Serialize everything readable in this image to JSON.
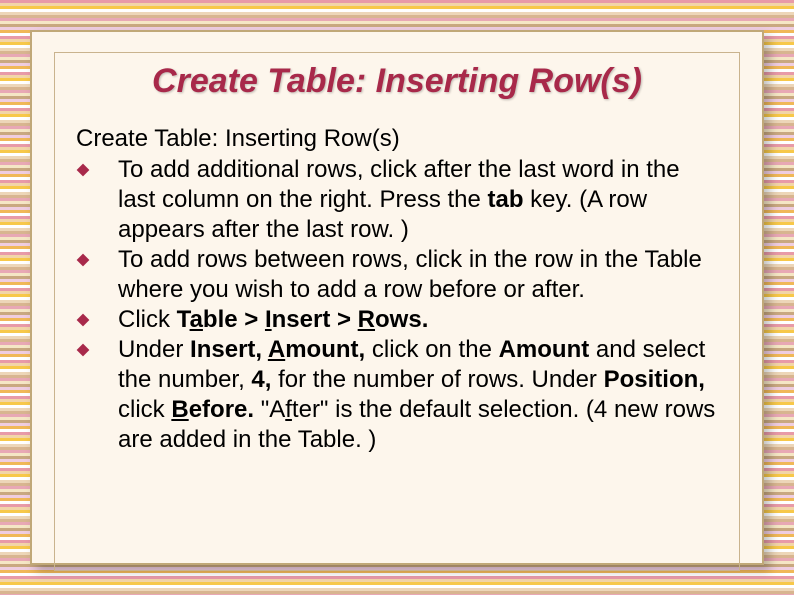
{
  "title": "Create Table: Inserting Row(s)",
  "subtitle": "Create Table: Inserting Row(s)",
  "icon_fill": "#a8294a",
  "bullets": [
    {
      "segments": [
        {
          "t": "To add additional rows, click after the last word in the last column on the right. Press the "
        },
        {
          "t": "tab",
          "b": true
        },
        {
          "t": " key. (A row appears after the last row. )"
        }
      ]
    },
    {
      "segments": [
        {
          "t": "To add rows between rows, click in the row in the Table where you wish to add a row before or after."
        }
      ]
    },
    {
      "segments": [
        {
          "t": "Click "
        },
        {
          "t": "T",
          "b": true
        },
        {
          "t": "a",
          "b": true,
          "u": true
        },
        {
          "t": "ble > ",
          "b": true
        },
        {
          "t": "I",
          "b": true,
          "u": true
        },
        {
          "t": "nsert > ",
          "b": true
        },
        {
          "t": "R",
          "b": true,
          "u": true
        },
        {
          "t": "ows.",
          "b": true
        }
      ]
    },
    {
      "segments": [
        {
          "t": "Under "
        },
        {
          "t": "Insert, ",
          "b": true
        },
        {
          "t": "A",
          "b": true,
          "u": true
        },
        {
          "t": "mount,",
          "b": true
        },
        {
          "t": " click on the "
        },
        {
          "t": "Amount",
          "b": true
        },
        {
          "t": " and select the number, "
        },
        {
          "t": "4,",
          "b": true
        },
        {
          "t": " for the number of rows. Under "
        },
        {
          "t": "Position,",
          "b": true
        },
        {
          "t": " click "
        },
        {
          "t": "B",
          "b": true,
          "u": true
        },
        {
          "t": "efore.",
          "b": true
        },
        {
          "t": " \"A"
        },
        {
          "t": "f",
          "u": true
        },
        {
          "t": "ter\" is the default selection. (4 new rows are added in the Table. )"
        }
      ]
    }
  ]
}
